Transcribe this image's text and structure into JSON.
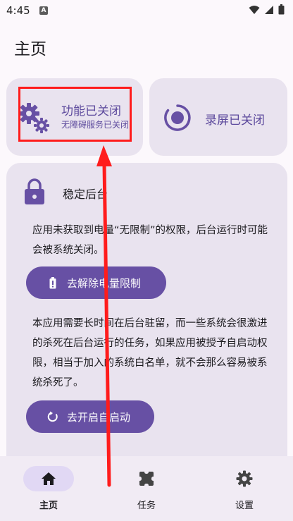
{
  "status_bar": {
    "time": "4:45",
    "notification_badge": "A"
  },
  "header": {
    "title": "主页"
  },
  "cards": {
    "function": {
      "title": "功能已关闭",
      "subtitle": "无障碍服务已关闭"
    },
    "record": {
      "title": "录屏已关闭"
    }
  },
  "stable_background": {
    "title": "稳定后台",
    "paragraph_1": "应用未获取到电量“无限制”的权限，后台运行时可能会被系统关闭。",
    "remove_power_limit_label": "去解除电量限制",
    "paragraph_2": "本应用需要长时间在后台驻留，而一些系统会很激进的杀死在后台运行的任务，如果应用被授予自启动权限，相当于加入的系统白名单，就不会那么容易被系统杀死了。",
    "enable_autostart_label": "去开启自启动"
  },
  "bottom_nav": {
    "items": [
      {
        "label": "主页",
        "icon": "home-icon",
        "selected": true
      },
      {
        "label": "任务",
        "icon": "task-icon",
        "selected": false
      },
      {
        "label": "设置",
        "icon": "settings-icon",
        "selected": false
      }
    ]
  },
  "colors": {
    "accent": "#6750a4",
    "accent_text": "#5d4a9d",
    "card_background": "#e9e3ef",
    "annotation": "#ff1c1c"
  }
}
